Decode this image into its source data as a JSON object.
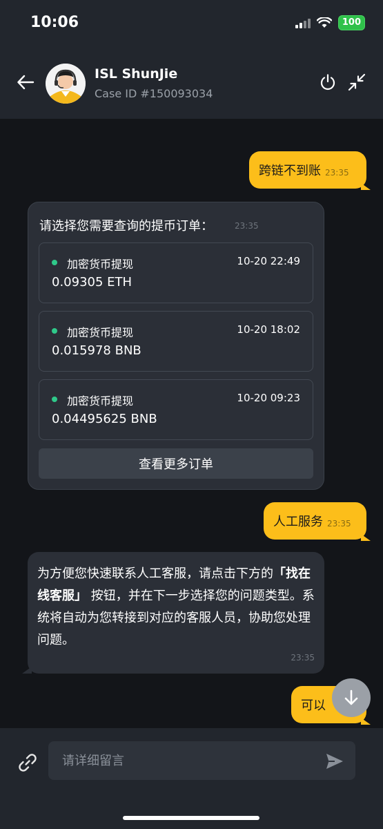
{
  "status_bar": {
    "time": "10:06",
    "battery": "100"
  },
  "header": {
    "agent_name": "ISL ShunJie",
    "case_id": "Case ID #150093034"
  },
  "messages": {
    "out1": {
      "text": "跨链不到账",
      "time": "23:35"
    },
    "card": {
      "title": "请选择您需要查询的提币订单：",
      "time": "23:35",
      "orders": [
        {
          "type": "加密货币提现",
          "date": "10-20 22:49",
          "amount": "0.09305 ETH"
        },
        {
          "type": "加密货币提现",
          "date": "10-20 18:02",
          "amount": "0.015978 BNB"
        },
        {
          "type": "加密货币提现",
          "date": "10-20 09:23",
          "amount": "0.04495625 BNB"
        }
      ],
      "more_button": "查看更多订单"
    },
    "out2": {
      "text": "人工服务",
      "time": "23:35"
    },
    "in1": {
      "text_before": "为方便您快速联系人工客服，请点击下方的",
      "bold": "「找在线客服」",
      "text_after": " 按钮，并在下一步选择您的问题类型。系统将自动为您转接到对应的客服人员，协助您处理问题。",
      "time": "23:35"
    },
    "out3": {
      "text": "可以"
    }
  },
  "input": {
    "placeholder": "请详细留言"
  },
  "colors": {
    "accent": "#fcbe1a",
    "background": "#131519",
    "bubble_in": "#2b2f37",
    "status_dot": "#2fc98a"
  }
}
